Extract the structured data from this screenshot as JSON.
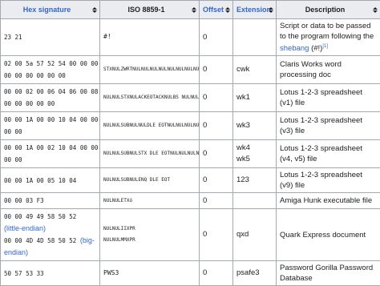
{
  "headers": {
    "hex": "Hex signature",
    "iso": "ISO 8859-1",
    "offset": "Offset",
    "extension": "Extension",
    "description": "Description"
  },
  "rows": [
    {
      "hex": "23 21",
      "iso": "#!",
      "offset": "0",
      "ext": "",
      "desc_pre": "Script or data to be passed to the program following the ",
      "desc_link": "shebang",
      "desc_post": " (#!)",
      "desc_ref": "[1]"
    },
    {
      "hex1": "02 00 5a 57 52 54 00 00 00 00",
      "hex2": "00 00 00 00 00 00",
      "iso": "STXNULZWRTNULNULNULNULNULNULNULNULNULNUL",
      "offset": "0",
      "ext": "cwk",
      "desc": "Claris Works word processing doc"
    },
    {
      "hex1": "00 00 02 00 06 04 06 00 08 00",
      "hex2": "00 00 00 00 00",
      "iso": "NULNULSTXNULACKEOTACKNULBS NULNULNULNULNUL",
      "offset": "0",
      "ext": "wk1",
      "desc": "Lotus 1-2-3 spreadsheet (v1) file"
    },
    {
      "hex1": "00 00 1A 00 00 10 04 00 00 00",
      "hex2": "00 00",
      "iso": "NULNULSUBNULNULDLE EOTNULNULNULNULNUL",
      "offset": "0",
      "ext": "wk3",
      "desc": "Lotus 1-2-3 spreadsheet (v3) file"
    },
    {
      "hex1": "00 00 1A 00 02 10 04 00 00 00",
      "hex2": "00 00",
      "iso": "NULNULSUBNULSTX DLE EOTNULNULNULNULNUL",
      "offset": "0",
      "ext1": "wk4",
      "ext2": "wk5",
      "desc": "Lotus 1-2-3 spreadsheet (v4, v5) file"
    },
    {
      "hex1": "00 00 1A 00 05 10 04",
      "iso": "NULNULSUBNULENQ DLE EOT",
      "offset": "0",
      "ext": "123",
      "desc": "Lotus 1-2-3 spreadsheet (v9) file"
    },
    {
      "hex": "00 00 03 F3",
      "iso": "NULNULETXó",
      "offset": "0",
      "ext": "",
      "desc": "Amiga Hunk executable file"
    },
    {
      "hex1": "00 00 49 49 58 50 52",
      "link1": "(little-endian)",
      "hex2": "00 00 4D 4D 58 50 52",
      "link2": "(big-endian)",
      "iso1": "NULNULIIXPR",
      "iso2": "NULNULMMXPR",
      "offset": "0",
      "ext": "qxd",
      "desc": "Quark Express document"
    },
    {
      "hex": "50 57 53 33",
      "iso": "PWS3",
      "offset": "0",
      "ext": "psafe3",
      "desc": "Password Gorilla Password Database"
    }
  ]
}
